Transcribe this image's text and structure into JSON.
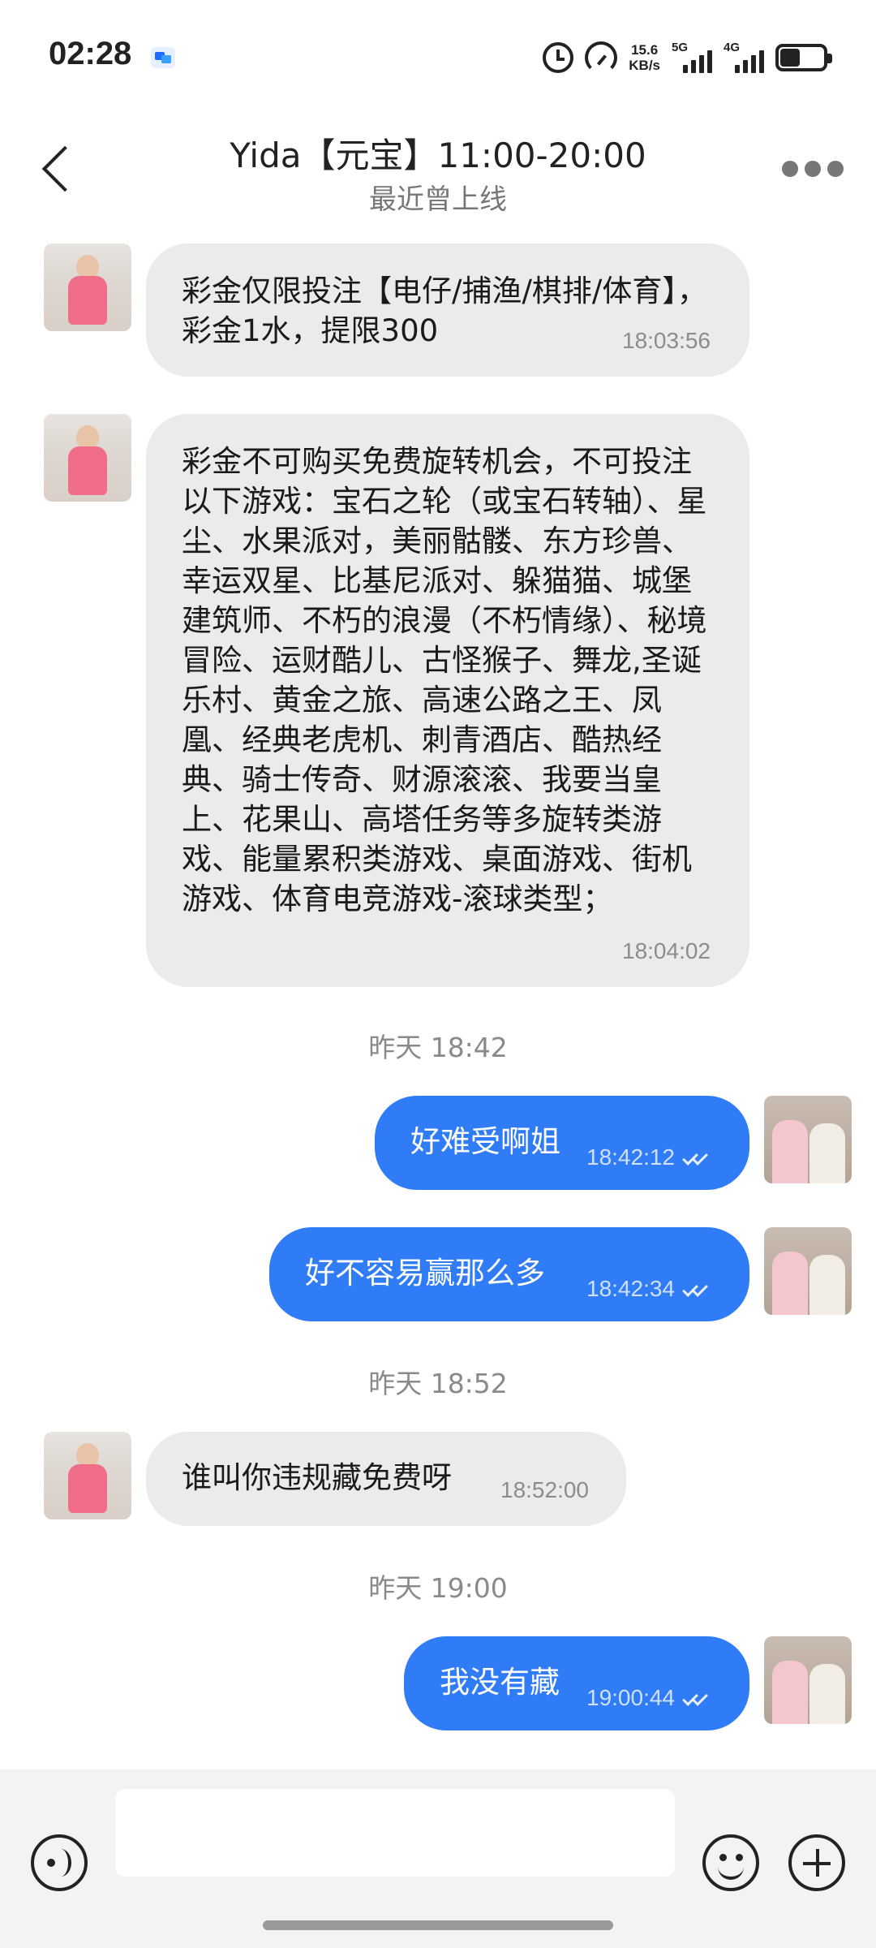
{
  "status_bar": {
    "time": "02:28",
    "net_speed_value": "15.6",
    "net_speed_unit": "KB/s",
    "signal1": "5G",
    "signal2": "4G"
  },
  "header": {
    "title": "Yida【元宝】11:00-20:00",
    "subtitle": "最近曾上线"
  },
  "messages": [
    {
      "direction": "in",
      "text": "彩金仅限投注【电仔/捕渔/棋排/体育】，彩金1水，提限300",
      "time": "18:03:56"
    },
    {
      "direction": "in",
      "text": "彩金不可购买免费旋转机会，不可投注以下游戏：宝石之轮（或宝石转轴）、星尘、水果派对，美丽骷髅、东方珍兽、幸运双星、比基尼派对、躲猫猫、城堡建筑师、不朽的浪漫（不朽情缘）、秘境冒险、运财酷儿、古怪猴子、舞龙,圣诞乐村、黄金之旅、高速公路之王、凤凰、经典老虎机、刺青酒店、酷热经典、骑士传奇、财源滚滚、我要当皇上、花果山、高塔任务等多旋转类游戏、能量累积类游戏、桌面游戏、街机游戏、体育电竞游戏-滚球类型；",
      "time": "18:04:02"
    },
    {
      "direction": "separator",
      "text": "昨天 18:42"
    },
    {
      "direction": "out",
      "text": "好难受啊姐",
      "time": "18:42:12"
    },
    {
      "direction": "out",
      "text": "好不容易赢那么多",
      "time": "18:42:34"
    },
    {
      "direction": "separator",
      "text": "昨天 18:52"
    },
    {
      "direction": "in",
      "text": "谁叫你违规藏免费呀",
      "time": "18:52:00"
    },
    {
      "direction": "separator",
      "text": "昨天 19:00"
    },
    {
      "direction": "out",
      "text": "我没有藏",
      "time": "19:00:44"
    }
  ],
  "input": {
    "value": "",
    "placeholder": ""
  },
  "colors": {
    "outgoing_bubble": "#2f7cf6",
    "incoming_bubble": "#ebebeb",
    "input_bar": "#f3f3f3"
  }
}
